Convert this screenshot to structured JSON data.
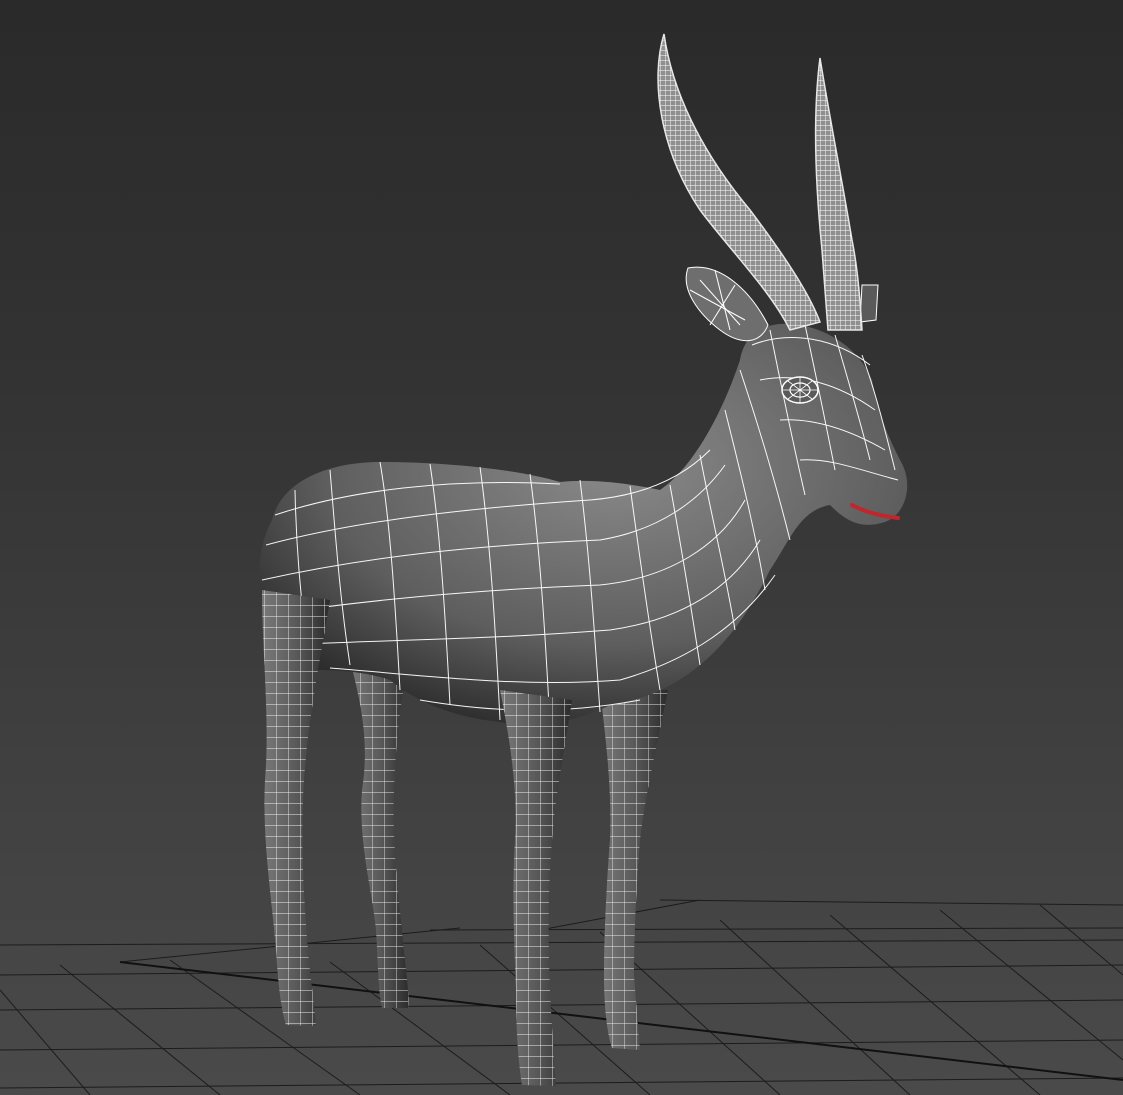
{
  "viewport": {
    "type": "3d-perspective-viewport",
    "shading": "smooth-shaded-with-wireframe-overlay",
    "background_top_color": "#2a2a2a",
    "background_bottom_color": "#4a4a4a",
    "grid_color": "#1a1a1a",
    "wire_color": "#ffffff",
    "shade_color": "#6a6a6a",
    "mouth_color": "#c0262b"
  },
  "model": {
    "subject": "gazelle",
    "parts": [
      "body",
      "neck",
      "head",
      "left-ear",
      "left-horn",
      "right-horn",
      "right-ear",
      "eye",
      "mouth",
      "front-leg-near",
      "front-leg-far",
      "hind-leg-near",
      "hind-leg-far"
    ]
  }
}
